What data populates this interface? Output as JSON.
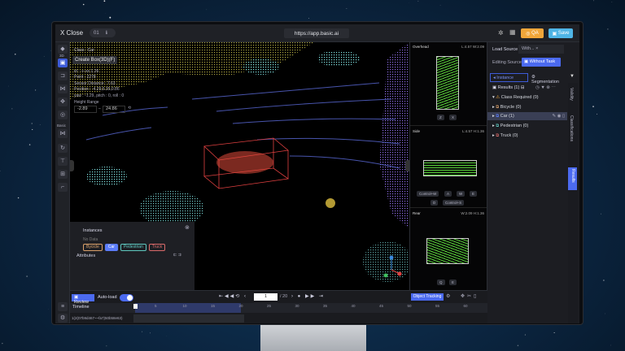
{
  "header": {
    "close_label": "X Close",
    "frame_badge": "01",
    "frame_info_icon": "info-icon",
    "url": "https://app.basic.ai",
    "qa_label": "QA",
    "save_label": "Save",
    "colors": {
      "qa": "#f0a63a",
      "save": "#4fb5e6"
    }
  },
  "left_toolbar": {
    "mode_3d": "3D",
    "section_basic": "Basic",
    "icons": [
      "cube-icon",
      "create-box-icon",
      "polyline-icon",
      "fit-icon",
      "move-icon",
      "focus-icon",
      "ruler-icon",
      "rotate-icon",
      "filter-icon",
      "cluster-icon",
      "crop-icon"
    ],
    "bottom_icons": [
      "list-icon",
      "settings-icon"
    ]
  },
  "canvas_info": {
    "class_line": "Class : Car",
    "tooltip": "Create Box(3D)(F)",
    "id_line": "id : -i--xx   1.26",
    "point_line": "Point : 2278",
    "distance_line": "Sensor Distance : 7.63",
    "position_line": "Position : -4.29,6.35,0.86",
    "rotation_line": "yaw : -1.29, pitch : 0, roll : 0",
    "height_range_label": "Height Range",
    "height_min": "-2.89",
    "height_max": "24.86"
  },
  "instances_panel": {
    "title": "Instances",
    "no_data": "No Data",
    "classes": [
      {
        "label": "Bycicle",
        "color": "#d9a06a"
      },
      {
        "label": "Car",
        "color": "#5b7cfa",
        "active": true
      },
      {
        "label": "Pedestrian",
        "color": "#5ec8c0"
      },
      {
        "label": "Truck",
        "color": "#d96a6a"
      }
    ],
    "attributes_label": "Attributes"
  },
  "views": {
    "overhead": {
      "title": "Overhead",
      "dims": "L:4.57 W:2.09",
      "buttons": [
        "Z",
        "X"
      ]
    },
    "side": {
      "title": "Side",
      "dims": "L:4.57 H:1.36",
      "buttons": [
        "Control+W",
        "A",
        "W",
        "E",
        "D",
        "Control+S"
      ]
    },
    "rear": {
      "title": "Rear",
      "dims": "W:2.09 H:1.36",
      "buttons": [
        "Q",
        "E"
      ]
    }
  },
  "right_panel": {
    "load_source_label": "Load Source",
    "load_source_value": "With...",
    "editing_source_label": "Editing Source",
    "editing_source_value": "Without Task",
    "tabs": [
      "Instance",
      "Segmentation"
    ],
    "results_label": "Results (1)",
    "side_tabs": [
      "Validity",
      "Classifications",
      "Results"
    ],
    "tree": [
      {
        "label": "Class Required (0)",
        "type": "group"
      },
      {
        "label": "Bicycle (0)",
        "color": "#d9a06a"
      },
      {
        "label": "Car (1)",
        "color": "#5b7cfa",
        "selected": true
      },
      {
        "label": "Pedestrian (0)",
        "color": "#5ec8c0"
      },
      {
        "label": "Truck (0)",
        "color": "#d96a6a"
      }
    ]
  },
  "bottom": {
    "review_label": "Review",
    "autoload_label": "Auto-load",
    "autoload_on": true,
    "current_frame": "1",
    "total_frames": "/ 20",
    "object_tracking_label": "Object Tracking",
    "timeline_label": "Timeline",
    "ticks": [
      "5",
      "10",
      "15",
      "20",
      "25",
      "30",
      "35",
      "40",
      "45",
      "50",
      "55",
      "60"
    ],
    "track_id": "1(2(07b9d467~~fa7)50b58e63)"
  }
}
